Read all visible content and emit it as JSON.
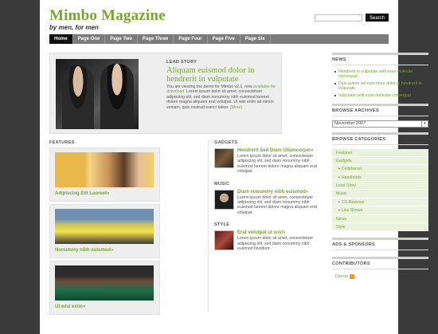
{
  "site": {
    "title": "Mimbo Magazine",
    "tagline": "by men, for men",
    "search_button": "Search"
  },
  "nav": [
    "Home",
    "Page One",
    "Page Two",
    "Page Three",
    "Page Four",
    "Page Five",
    "Page Six"
  ],
  "lead": {
    "label": "LEAD STORY",
    "title": "Aliquam euismod dolor in hendrerit in vulputate",
    "intro": "You are viewing the demo for Mimbo v2.1, now ",
    "intro_link": "available for download.",
    "body": " Lorem ipsum dolor sit amet, consectetuer adipiscing elit, sed diam nonummy nibh euismod laoreet dolore magna aliquam erat volutpat. Ut wisi enim ad minim veniam, quis nostrud exerci tation.",
    "more": "[More]"
  },
  "features": {
    "heading": "FEATURES",
    "items": [
      {
        "caption": "Adipiscing Elit Laoreet»"
      },
      {
        "caption": "Nonummy nibh euismod»"
      },
      {
        "caption": "Ut wisi enim»"
      }
    ]
  },
  "sections": [
    {
      "heading": "GADGETS",
      "title": "Hendrerit Sed Diam Ullamcorper»",
      "body": "Lorem ipsum dolor sit amet, consectetuer adipiscing elit, sed diam nonummy nibh euismod laoreet dolore magna aliquam erat volutpat."
    },
    {
      "heading": "MUSIC",
      "title": "Diam nonummy nibh euismod»",
      "body": "Lorem ipsum dolor sit amet, consectetuer adipiscing elit, sed diam nonummy nibh euismod laoreet dolore magna aliquam erat volutpat."
    },
    {
      "heading": "STYLE",
      "title": "Erat volutpat ut wisi»",
      "body": "Lorem ipsum dolor sit amet, consectetuer adipiscing elit, sed diam nonummy nibh euismod tincidunt."
    }
  ],
  "sidebar": {
    "news_heading": "NEWS",
    "news": [
      "Hendrerit in vulputate velit esse molestie consequat",
      "Duis autem vel eum iriure dolor in hendrerit in vulputate",
      "Vulputate velit esse molestie consequat"
    ],
    "archives_heading": "BROWSE ARCHIVES",
    "archive_selected": "November 2007",
    "categories_heading": "BROWSE CATEGORIES",
    "categories": [
      {
        "label": "Features",
        "sub": false
      },
      {
        "label": "Gadgets",
        "sub": false
      },
      {
        "label": "Cellphones",
        "sub": true
      },
      {
        "label": "Handhelds",
        "sub": true
      },
      {
        "label": "Lead Story",
        "sub": false
      },
      {
        "label": "Music",
        "sub": false
      },
      {
        "label": "CD Reviews",
        "sub": true
      },
      {
        "label": "Live Shows",
        "sub": true
      },
      {
        "label": "News",
        "sub": false
      },
      {
        "label": "Style",
        "sub": false
      }
    ],
    "ads_heading": "ADS & SPONSORS",
    "contributors_heading": "CONTRIBUTORS",
    "contributor": "Darren"
  },
  "colors": {
    "accent": "#7aa330",
    "nav_bg": "#7b7b7b",
    "page_bg": "#3a3a3a"
  }
}
